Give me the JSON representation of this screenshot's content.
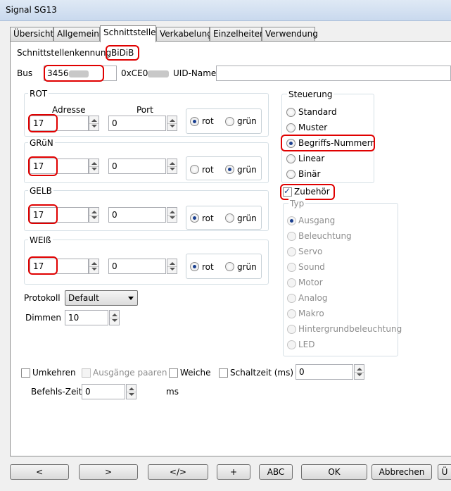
{
  "window": {
    "title": "Signal SG13"
  },
  "tabs": [
    "Übersicht",
    "Allgemein",
    "Schnittstelle",
    "Verkabelung",
    "Einzelheiten",
    "Verwendung"
  ],
  "interface": {
    "label": "Schnittstellenkennung",
    "value": "BiDiB",
    "bus_label": "Bus",
    "bus_value": "3456",
    "uid_value": "0xCE0",
    "uid_name_label": "UID-Name",
    "uid_name_value": ""
  },
  "aspect_headers": {
    "address": "Adresse",
    "port": "Port"
  },
  "aspects": [
    {
      "name": "ROT",
      "address": "17",
      "port": "0",
      "opt1": "rot",
      "opt2": "grün",
      "selected": "rot"
    },
    {
      "name": "GRüN",
      "address": "17",
      "port": "0",
      "opt1": "rot",
      "opt2": "grün",
      "selected": "grün"
    },
    {
      "name": "GELB",
      "address": "17",
      "port": "0",
      "opt1": "rot",
      "opt2": "grün",
      "selected": "rot"
    },
    {
      "name": "WEIß",
      "address": "17",
      "port": "0",
      "opt1": "rot",
      "opt2": "grün",
      "selected": "rot"
    }
  ],
  "control": {
    "label": "Steuerung",
    "options": [
      "Standard",
      "Muster",
      "Begriffs-Nummern",
      "Linear",
      "Binär"
    ],
    "selected": "Begriffs-Nummern"
  },
  "accessory": {
    "label": "Zubehör",
    "checked": true
  },
  "type": {
    "label": "Typ",
    "options": [
      "Ausgang",
      "Beleuchtung",
      "Servo",
      "Sound",
      "Motor",
      "Analog",
      "Makro",
      "Hintergrundbeleuchtung",
      "LED"
    ],
    "selected": "Ausgang"
  },
  "protocol": {
    "label": "Protokoll",
    "value": "Default"
  },
  "dimming": {
    "label": "Dimmen",
    "value": "10"
  },
  "options": {
    "reverse": "Umkehren",
    "pair_outputs": "Ausgänge paaren",
    "switch": "Weiche",
    "switch_time": "Schaltzeit (ms)",
    "switch_time_value": "0"
  },
  "command_time": {
    "label": "Befehls-Zeit",
    "value": "0",
    "unit": "ms"
  },
  "buttons": [
    "<",
    ">",
    "</>",
    "+",
    "ABC",
    "OK",
    "Abbrechen",
    "Ü"
  ],
  "colors": {
    "highlight": "#e00000",
    "selection": "#1a3f8f"
  }
}
